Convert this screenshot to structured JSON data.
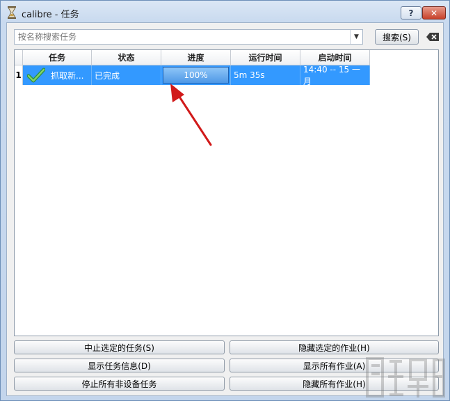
{
  "window": {
    "title": "calibre - 任务",
    "help_label": "?",
    "close_label": "✕"
  },
  "search": {
    "placeholder": "按名称搜索任务",
    "search_button": "搜索(S)"
  },
  "table": {
    "columns": [
      "任务",
      "状态",
      "进度",
      "运行时间",
      "启动时间"
    ],
    "rows": [
      {
        "index": "1",
        "task": "抓取新...",
        "status": "已完成",
        "progress_text": "100%",
        "progress_value": 100,
        "runtime": "5m 35s",
        "start_time": "14:40 -- 15 一月"
      }
    ]
  },
  "buttons": {
    "abort_selected": "中止选定的任务(S)",
    "hide_selected": "隐藏选定的作业(H)",
    "show_info": "显示任务信息(D)",
    "show_all": "显示所有作业(A)",
    "stop_non_device": "停止所有非设备任务",
    "hide_all": "隐藏所有作业(H)"
  },
  "colors": {
    "selection": "#3399ff",
    "annotation_arrow": "#d11a1a",
    "check_icon": "#3ea84a"
  },
  "icons": {
    "app": "hourglass-icon",
    "clear": "backspace-icon",
    "row_status": "checkmark-icon",
    "combo": "chevron-down-icon"
  }
}
